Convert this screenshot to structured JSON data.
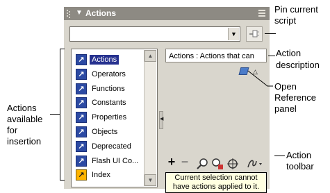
{
  "panel": {
    "title": "Actions"
  },
  "actions_list": [
    {
      "label": "Actions",
      "icon": "book-icon",
      "selected": true
    },
    {
      "label": "Operators",
      "icon": "book-icon"
    },
    {
      "label": "Functions",
      "icon": "book-icon"
    },
    {
      "label": "Constants",
      "icon": "book-icon"
    },
    {
      "label": "Properties",
      "icon": "book-icon"
    },
    {
      "label": "Objects",
      "icon": "book-icon"
    },
    {
      "label": "Deprecated",
      "icon": "book-icon"
    },
    {
      "label": "Flash UI Co...",
      "icon": "book-icon"
    },
    {
      "label": "Index",
      "icon": "index-book-icon"
    }
  ],
  "description_text": "Actions : Actions that can",
  "tooltip": {
    "line1": "Current selection cannot",
    "line2": "have actions applied to it."
  },
  "toolbar": [
    "+",
    "−",
    "🔍",
    "?",
    "⊕",
    "✎"
  ],
  "callouts": {
    "pin": [
      "Pin current",
      "script"
    ],
    "action_description": [
      "Action",
      "description"
    ],
    "open_reference": [
      "Open",
      "Reference",
      "panel"
    ],
    "action_toolbar": [
      "Action",
      "toolbar"
    ],
    "actions_available": [
      "Actions",
      "available",
      "for",
      "insertion"
    ]
  },
  "colors": {
    "selection": "#26318f",
    "panel_bg": "#d9d6cd",
    "titlebar": "#8d8a83",
    "tooltip_bg": "#ffffe1"
  }
}
